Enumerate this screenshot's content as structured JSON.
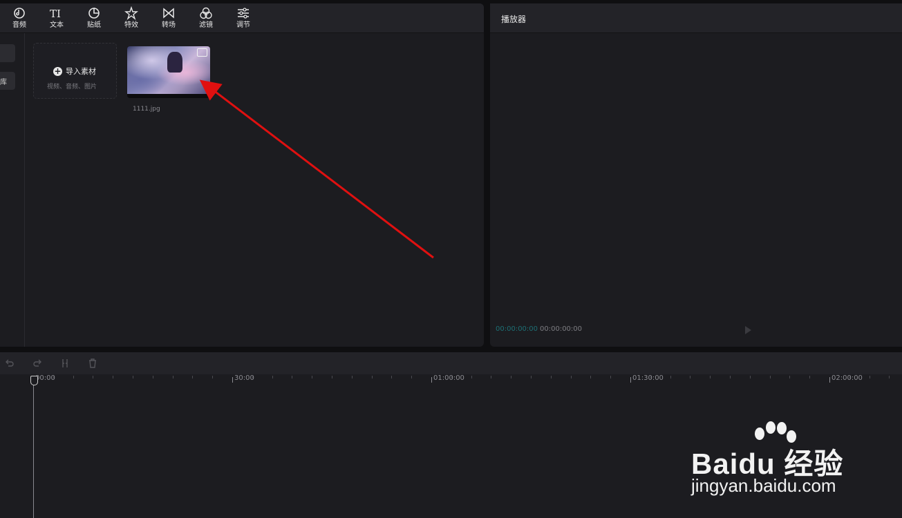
{
  "toolbar": {
    "items": [
      {
        "label": "音频",
        "icon": "audio-icon"
      },
      {
        "label": "文本",
        "icon": "text-icon"
      },
      {
        "label": "贴纸",
        "icon": "sticker-icon"
      },
      {
        "label": "特效",
        "icon": "effects-icon"
      },
      {
        "label": "转场",
        "icon": "transition-icon"
      },
      {
        "label": "滤镜",
        "icon": "filter-icon"
      },
      {
        "label": "调节",
        "icon": "adjust-icon"
      }
    ]
  },
  "sidebar": {
    "second_item_label": "库"
  },
  "media": {
    "import_label": "导入素材",
    "import_hint": "视频、音频、图片",
    "items": [
      {
        "name": "1111.jpg",
        "type": "image"
      }
    ]
  },
  "annotation": {
    "arrow_color": "#e01010"
  },
  "player": {
    "title": "播放器",
    "current_time": "00:00:00:00",
    "total_time": "00:00:00:00"
  },
  "timeline": {
    "tools": [
      "undo-icon",
      "redo-icon",
      "split-icon",
      "delete-icon"
    ],
    "ruler_labels": [
      "00:00",
      "30:00",
      "01:00:00",
      "01:30:00",
      "02:00:00"
    ]
  },
  "watermark": {
    "brand": "Baidu 经验",
    "url": "jingyan.baidu.com"
  },
  "colors": {
    "panel_bg": "#1c1c20",
    "header_bg": "#232328",
    "timecode_accent": "#1d6f74"
  }
}
